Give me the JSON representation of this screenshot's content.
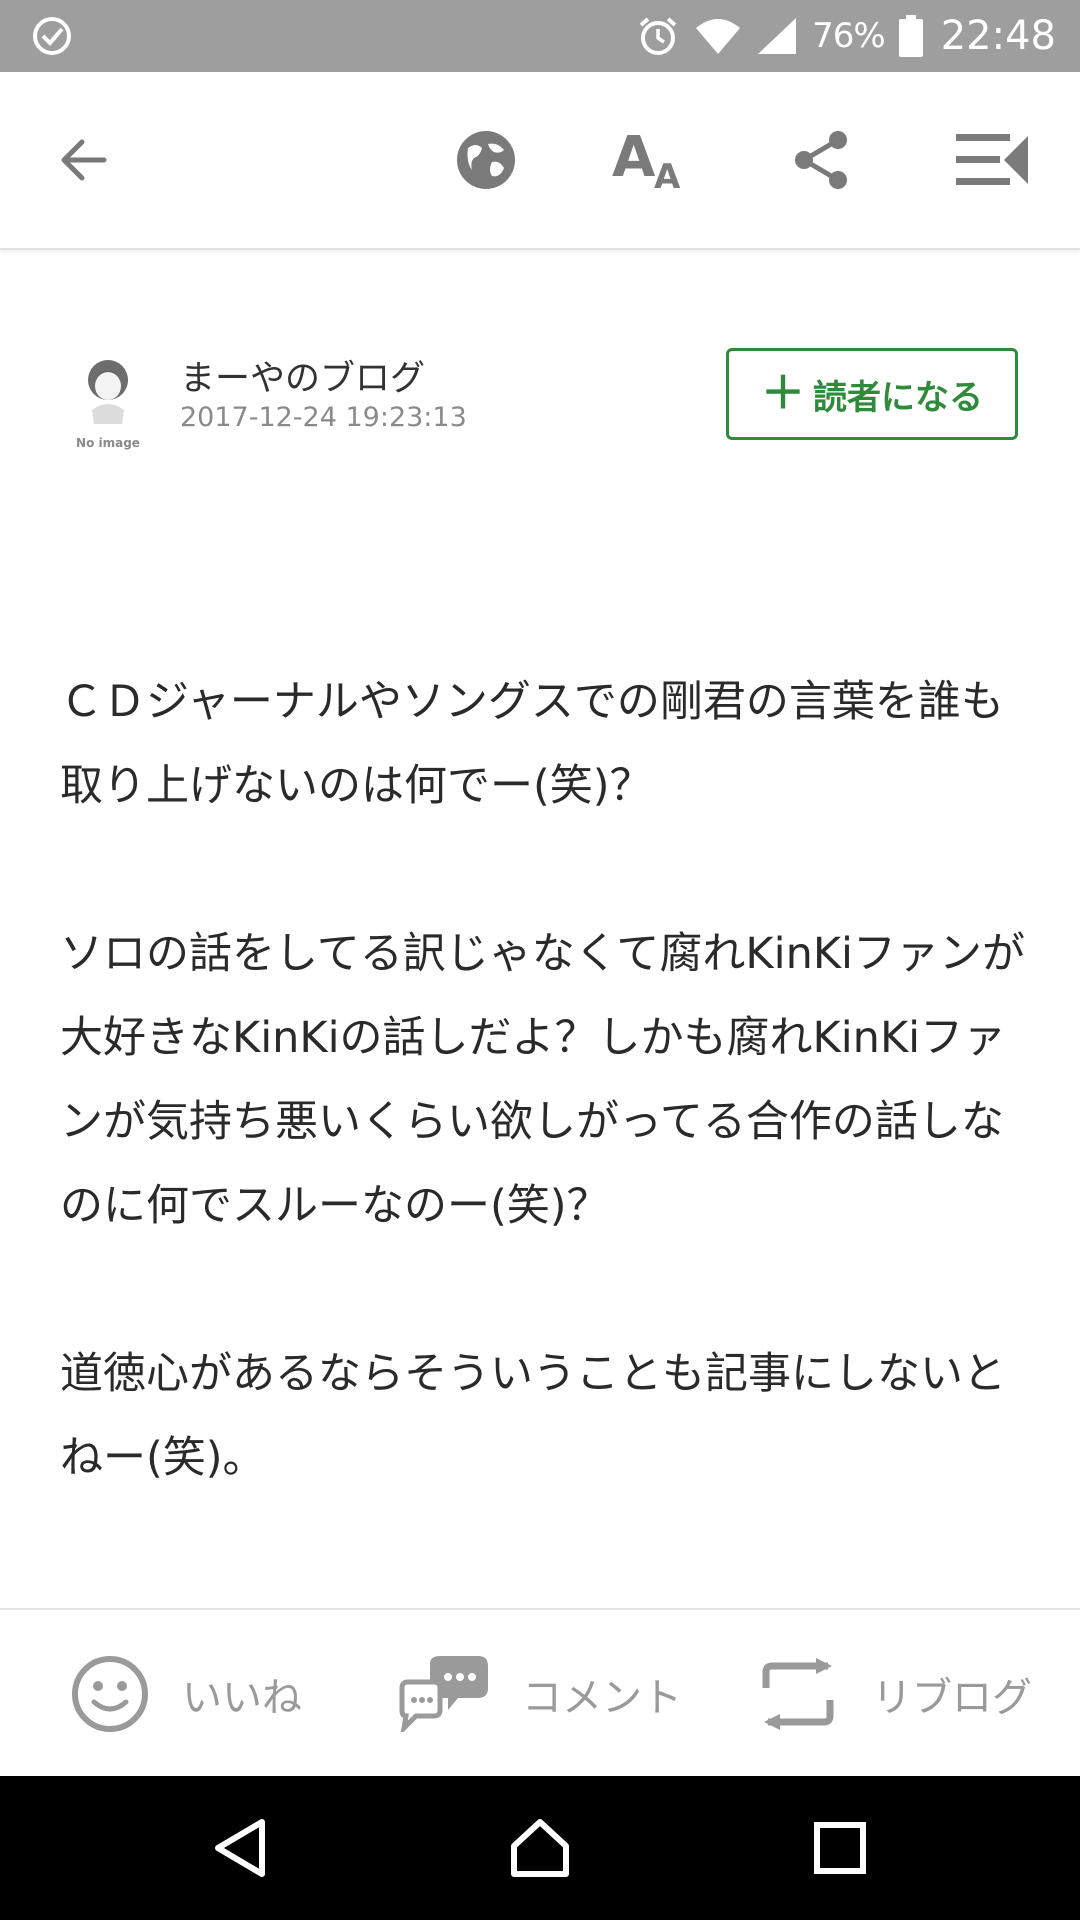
{
  "status_bar": {
    "battery_percent": "76%",
    "time": "22:48"
  },
  "toolbar": {
    "icons": [
      "back-arrow-icon",
      "globe-icon",
      "font-size-icon",
      "share-icon",
      "menu-icon"
    ]
  },
  "author": {
    "avatar_caption": "No image",
    "blog_name": "まーやのブログ",
    "date": "2017-12-24 19:23:13",
    "follow_label": "読者になる",
    "follow_color": "#2e8b3a"
  },
  "article": {
    "paragraphs": [
      "ＣＤジャーナルやソングスでの剛君の言葉を誰も取り上げないのは何でー(笑)？",
      "ソロの話をしてる訳じゃなくて腐れKinKiファンが大好きなKinKiの話しだよ？しかも腐れKinKiファンが気持ち悪いくらい欲しがってる合作の話しなのに何でスルーなのー(笑)？",
      "道徳心があるならそういうことも記事にしないとねー(笑)。"
    ]
  },
  "actions": {
    "like_label": "いいね",
    "comment_label": "コメント",
    "reblog_label": "リブログ"
  },
  "nav": {
    "icons": [
      "nav-back-icon",
      "nav-home-icon",
      "nav-recent-icon"
    ]
  }
}
